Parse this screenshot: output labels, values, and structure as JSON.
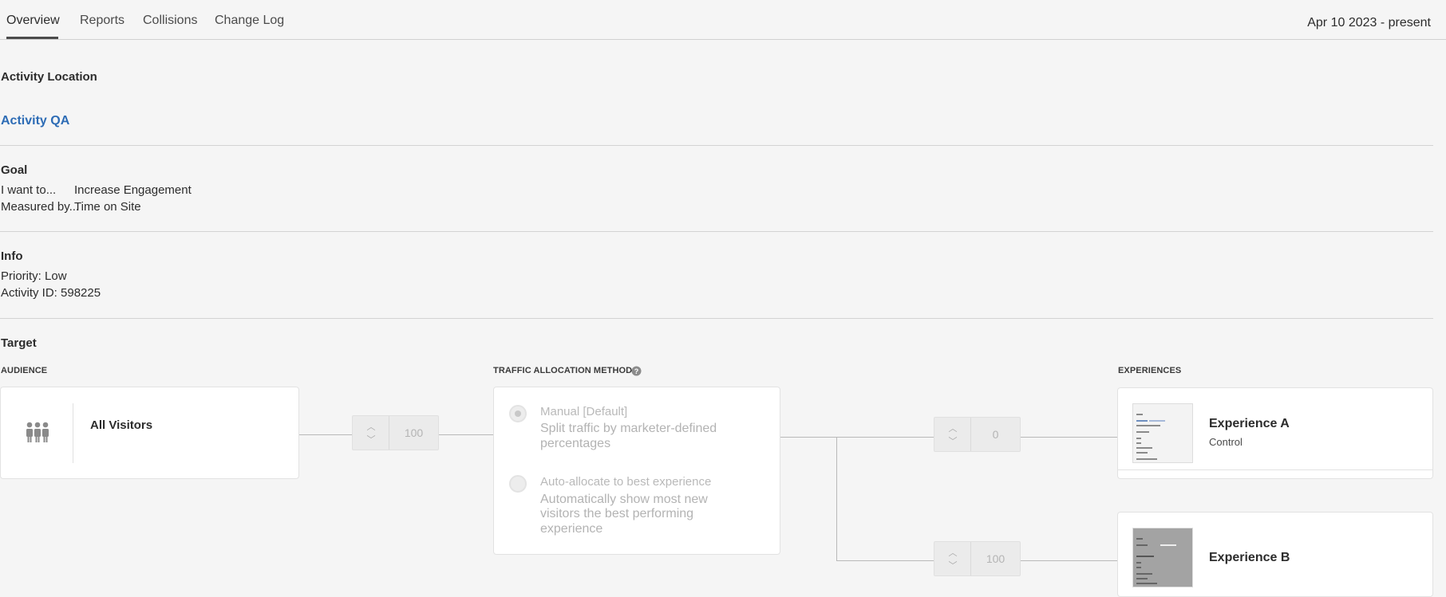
{
  "tabs": [
    {
      "label": "Overview"
    },
    {
      "label": "Reports"
    },
    {
      "label": "Collisions"
    },
    {
      "label": "Change Log"
    }
  ],
  "date_range": "Apr 10 2023 - present",
  "activity_location": {
    "heading": "Activity Location",
    "link": "Activity QA"
  },
  "goal": {
    "heading": "Goal",
    "want_label": "I want to...",
    "want_value": "Increase Engagement",
    "measured_label": "Measured by...",
    "measured_value": "Time on Site"
  },
  "info": {
    "heading": "Info",
    "priority": "Priority: Low",
    "activity_id": "Activity ID: 598225"
  },
  "target": {
    "heading": "Target",
    "audience_header": "AUDIENCE",
    "traffic_header": "TRAFFIC ALLOCATION METHOD",
    "experiences_header": "EXPERIENCES",
    "audience_name": "All Visitors",
    "audience_percent": "100",
    "traffic_options": [
      {
        "title": "Manual [Default]",
        "desc_line1": "Split traffic by marketer-defined",
        "desc_line2": "percentages"
      },
      {
        "title": "Auto-allocate to best experience",
        "desc_line1": "Automatically show most new",
        "desc_line2": "visitors the best performing",
        "desc_line3": "experience"
      }
    ],
    "experiences": [
      {
        "name": "Experience A",
        "subtitle": "Control",
        "percent": "0"
      },
      {
        "name": "Experience B",
        "percent": "100"
      }
    ]
  },
  "colors": {
    "link": "#2d6cb5",
    "background": "#f5f5f5",
    "card": "#ffffff",
    "disabled_text": "#b9b9b9"
  },
  "icons": {
    "audience": "people-group-icon",
    "help": "help-circle-icon",
    "step_up": "chevron-up-icon",
    "step_down": "chevron-down-icon"
  }
}
